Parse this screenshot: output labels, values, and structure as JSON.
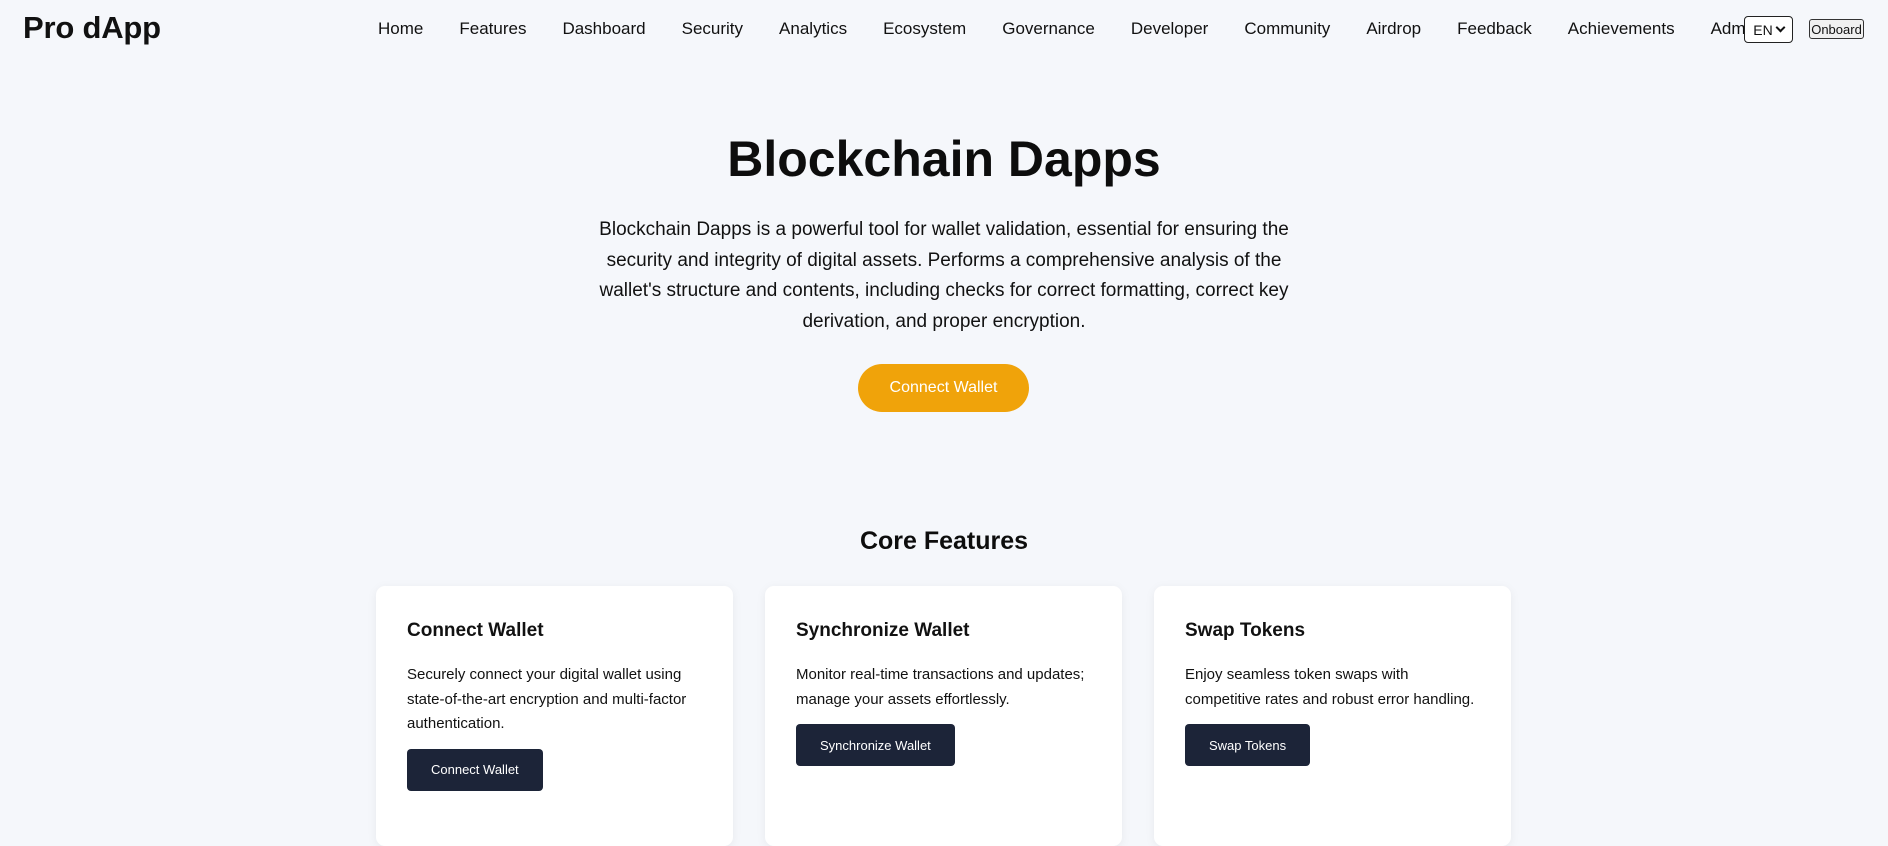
{
  "brand": "Pro dApp",
  "nav": [
    {
      "label": "Home",
      "name": "nav-home"
    },
    {
      "label": "Features",
      "name": "nav-features"
    },
    {
      "label": "Dashboard",
      "name": "nav-dashboard"
    },
    {
      "label": "Security",
      "name": "nav-security"
    },
    {
      "label": "Analytics",
      "name": "nav-analytics"
    },
    {
      "label": "Ecosystem",
      "name": "nav-ecosystem"
    },
    {
      "label": "Governance",
      "name": "nav-governance"
    },
    {
      "label": "Developer",
      "name": "nav-developer"
    },
    {
      "label": "Community",
      "name": "nav-community"
    },
    {
      "label": "Airdrop",
      "name": "nav-airdrop"
    },
    {
      "label": "Feedback",
      "name": "nav-feedback"
    },
    {
      "label": "Achievements",
      "name": "nav-achievements"
    },
    {
      "label": "Admin",
      "name": "nav-admin"
    }
  ],
  "language": {
    "selected": "EN",
    "icon": "chevron-down-icon"
  },
  "onboard_label": "Onboard",
  "hero": {
    "title": "Blockchain Dapps",
    "description": "Blockchain Dapps is a powerful tool for wallet validation, essential for ensuring the security and integrity of digital assets. Performs a comprehensive analysis of the wallet's structure and contents, including checks for correct formatting, correct key derivation, and proper encryption.",
    "cta_label": "Connect Wallet"
  },
  "features": {
    "title": "Core Features",
    "cards": [
      {
        "title": "Connect Wallet",
        "description": "Securely connect your digital wallet using state-of-the-art encryption and multi-factor authentication.",
        "button": "Connect Wallet"
      },
      {
        "title": "Synchronize Wallet",
        "description": "Monitor real-time transactions and updates; manage your assets effortlessly.",
        "button": "Synchronize Wallet"
      },
      {
        "title": "Swap Tokens",
        "description": "Enjoy seamless token swaps with competitive rates and robust error handling.",
        "button": "Swap Tokens"
      }
    ]
  },
  "colors": {
    "background": "#f5f7fb",
    "accent": "#f0a30a",
    "card_button": "#1c2438"
  }
}
